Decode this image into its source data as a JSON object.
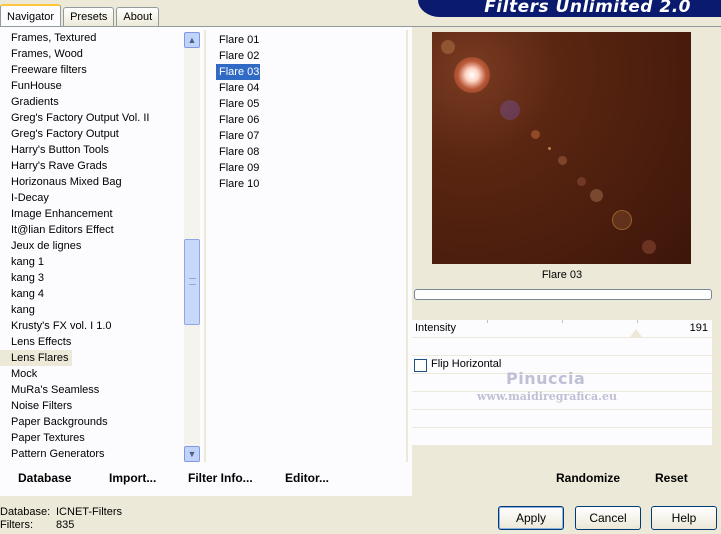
{
  "tabs": [
    {
      "label": "Navigator",
      "active": true
    },
    {
      "label": "Presets",
      "active": false
    },
    {
      "label": "About",
      "active": false
    }
  ],
  "banner": {
    "title": "Filters Unlimited 2.0"
  },
  "categories": [
    "Frames, Textured",
    "Frames, Wood",
    "Freeware filters",
    "FunHouse",
    "Gradients",
    "Greg's Factory Output Vol. II",
    "Greg's Factory Output",
    "Harry's Button Tools",
    "Harry's Rave Grads",
    "Horizonaus Mixed Bag",
    "I-Decay",
    "Image Enhancement",
    "It@lian Editors Effect",
    "Jeux de lignes",
    "kang 1",
    "kang 3",
    "kang 4",
    "kang",
    "Krusty's FX vol. I 1.0",
    "Lens Effects",
    "Lens Flares",
    "Mock",
    "MuRa's Seamless",
    "Noise Filters",
    "Paper Backgrounds",
    "Paper Textures",
    "Pattern Generators"
  ],
  "selected_category": "Lens Flares",
  "filters": [
    "Flare 01",
    "Flare 02",
    "Flare 03",
    "Flare 04",
    "Flare 05",
    "Flare 06",
    "Flare 07",
    "Flare 08",
    "Flare 09",
    "Flare 10"
  ],
  "selected_filter": "Flare 03",
  "preview": {
    "caption": "Flare 03"
  },
  "params": {
    "intensity_label": "Intensity",
    "intensity_value": "191",
    "flip_label": "Flip Horizontal",
    "flip_checked": false
  },
  "watermark": {
    "line1": "Pinuccia",
    "line2": "www.maidiregrafica.eu"
  },
  "toolbar": {
    "database": "Database",
    "import": "Import...",
    "filter_info": "Filter Info...",
    "editor": "Editor...",
    "randomize": "Randomize",
    "reset": "Reset"
  },
  "status": {
    "database_key": "Database:",
    "database_value": "ICNET-Filters",
    "filters_key": "Filters:",
    "filters_value": "835"
  },
  "buttons": {
    "apply": "Apply",
    "cancel": "Cancel",
    "help": "Help"
  },
  "colors": {
    "selection": "#316ac5",
    "banner": "#0a1a6e",
    "window": "#ece9d8"
  }
}
